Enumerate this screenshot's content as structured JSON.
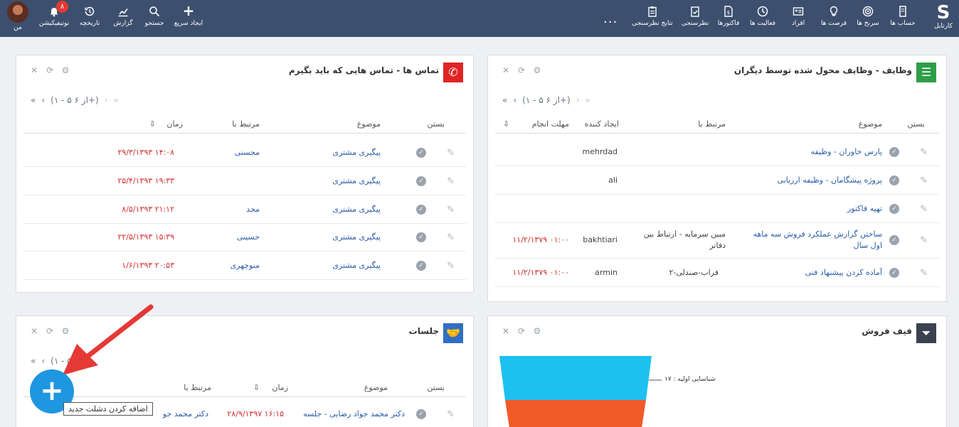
{
  "nav": {
    "brand": "کارتابل",
    "items": [
      {
        "id": "accounts",
        "label": "حساب ها"
      },
      {
        "id": "leads",
        "label": "سرنخ ها"
      },
      {
        "id": "opportunities",
        "label": "فرصت ها"
      },
      {
        "id": "persons",
        "label": "افراد"
      },
      {
        "id": "activities",
        "label": "فعالیت ها"
      },
      {
        "id": "invoices",
        "label": "فاکتورها"
      },
      {
        "id": "surveys",
        "label": "نظرسنجی"
      },
      {
        "id": "survey-results",
        "label": "نتایج نظرسنجی"
      }
    ],
    "more": "...",
    "right_items": [
      {
        "id": "quick-create",
        "label": "ایجاد سریع"
      },
      {
        "id": "search",
        "label": "جستجو"
      },
      {
        "id": "report",
        "label": "گزارش"
      },
      {
        "id": "history",
        "label": "تاریخچه"
      },
      {
        "id": "notifications",
        "label": "نوتیفیکیشن"
      }
    ],
    "notification_count": "۸",
    "me": "من"
  },
  "tasks": {
    "title": "وظایف - وظایف محول شده توسط دیگران",
    "pager": {
      "range": "(۱ - ۵ از ۶+)"
    },
    "columns": {
      "close": "بستن",
      "subject": "موضوع",
      "related": "مرتبط با",
      "creator": "ایجاد کننده",
      "due": "مهلت انجام"
    },
    "rows": [
      {
        "subject": "پارس خاوران - وظیفه",
        "related": "",
        "creator": "mehrdad",
        "due": ""
      },
      {
        "subject": "پروژه پیشگامان - وظیفه ارزیابی",
        "related": "",
        "creator": "ali",
        "due": ""
      },
      {
        "subject": "تهیه فاکتور",
        "related": "",
        "creator": "",
        "due": ""
      },
      {
        "subject": "ساختن گزارش عملکرد فروش سه ماهه اول سال",
        "related": "مبین سرمایه - ارتباط بین دفاتر",
        "creator": "bakhtiari",
        "due": "۱۱/۲/۱۳۷۹ ۰۱:۰۰"
      },
      {
        "subject": "آماده کردن پیشنهاد فنی",
        "related": "فراب-صندلی-۲",
        "creator": "armin",
        "due": "۱۱/۲/۱۳۷۹ ۰۱:۰۰"
      }
    ]
  },
  "calls": {
    "title": "تماس ها - تماس هایی که باید بگیرم",
    "pager": {
      "range": "(۱ - ۵ از ۶+)"
    },
    "columns": {
      "close": "بستن",
      "subject": "موضوع",
      "related": "مرتبط با",
      "time": "زمان"
    },
    "rows": [
      {
        "subject": "پیگیری مشتری",
        "related": "محسنی",
        "time": "۲۹/۳/۱۳۹۳ ۱۴:۰۸"
      },
      {
        "subject": "پیگیری مشتری",
        "related": "",
        "time": "۲۵/۴/۱۳۹۳ ۱۹:۳۳"
      },
      {
        "subject": "پیگیری مشتری",
        "related": "مجد",
        "time": "۸/۵/۱۳۹۳ ۲۱:۱۲"
      },
      {
        "subject": "پیگیری مشتری",
        "related": "حسینی",
        "time": "۲۲/۵/۱۳۹۳ ۱۵:۳۹"
      },
      {
        "subject": "پیگیری مشتری",
        "related": "منوچهری",
        "time": "۱/۶/۱۳۹۳ ۲۰:۵۳"
      }
    ]
  },
  "funnel": {
    "title": "قیف فروش",
    "label": "شناسایی اولیه : ۱۷",
    "colors": {
      "top": "#1ec0f0",
      "bottom": "#f05a28"
    }
  },
  "meetings": {
    "title": "جلسات",
    "pager": {
      "range": "(۱ - ۵"
    },
    "columns": {
      "close": "بستن",
      "subject": "موضوع",
      "time": "زمان",
      "related": "مرتبط با"
    },
    "rows": [
      {
        "subject": "دکتر محمد جواد رضایی - جلسه",
        "time": "۲۸/۹/۱۳۹۷ ۱۶:۱۵",
        "related": "دکتر محمد جو"
      }
    ]
  },
  "fab": {
    "label": "+",
    "tooltip": "اضافه کردن دشلت جدید"
  }
}
